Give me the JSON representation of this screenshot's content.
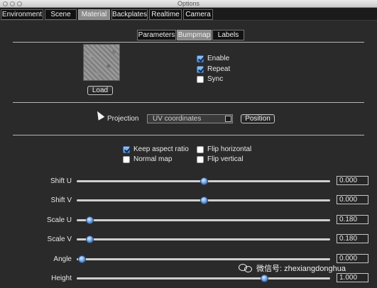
{
  "window": {
    "title": "Options"
  },
  "main_tabs": [
    {
      "label": "Environment",
      "active": false
    },
    {
      "label": "Scene",
      "active": false
    },
    {
      "label": "Material",
      "active": true
    },
    {
      "label": "Backplates",
      "active": false
    },
    {
      "label": "Realtime",
      "active": false
    },
    {
      "label": "Camera",
      "active": false
    }
  ],
  "sub_tabs": [
    {
      "label": "Parameters",
      "active": false
    },
    {
      "label": "Bumpmap",
      "active": true
    },
    {
      "label": "Labels",
      "active": false
    }
  ],
  "texture": {
    "load_label": "Load"
  },
  "options": {
    "enable": {
      "label": "Enable",
      "checked": true
    },
    "repeat": {
      "label": "Repeat",
      "checked": true
    },
    "sync": {
      "label": "Sync",
      "checked": false
    }
  },
  "projection": {
    "label": "Projection",
    "value": "UV coordinates",
    "position_label": "Position"
  },
  "flags": {
    "keep_aspect": {
      "label": "Keep aspect ratio",
      "checked": true
    },
    "normal_map": {
      "label": "Normal map",
      "checked": false
    },
    "flip_horizontal": {
      "label": "Flip horizontal",
      "checked": false
    },
    "flip_vertical": {
      "label": "Flip vertical",
      "checked": false
    }
  },
  "sliders": [
    {
      "label": "Shift U",
      "value": "0.000",
      "level": 0.5
    },
    {
      "label": "Shift V",
      "value": "0.000",
      "level": 0.5
    },
    {
      "label": "Scale U",
      "value": "0.180",
      "level": 0.05
    },
    {
      "label": "Scale V",
      "value": "0.180",
      "level": 0.05
    },
    {
      "label": "Angle",
      "value": "0.000",
      "level": 0.02
    },
    {
      "label": "Height",
      "value": "1.000",
      "level": 0.74
    }
  ],
  "watermark": {
    "text": "微信号: zhexiangdonghua"
  },
  "colors": {
    "accent": "#4f8cd6",
    "background": "#2a2a2a",
    "active_tab": "#8a8a8a"
  }
}
